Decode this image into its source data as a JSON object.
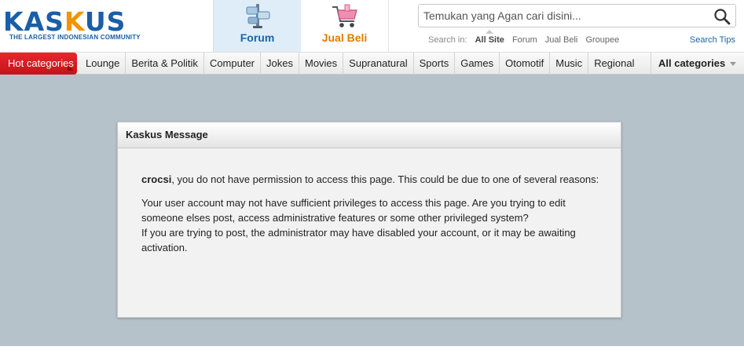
{
  "logo": {
    "text_a": "KAS",
    "text_o": "K",
    "text_b": "US",
    "tagline": "THE LARGEST INDONESIAN COMMUNITY"
  },
  "nav": {
    "forum_label": "Forum",
    "jualbeli_label": "Jual Beli"
  },
  "search": {
    "placeholder": "Temukan yang Agan cari disini...",
    "scope_label": "Search in:",
    "scopes": [
      "All Site",
      "Forum",
      "Jual Beli",
      "Groupee"
    ],
    "tips": "Search Tips"
  },
  "categories": {
    "hot": "Hot categories",
    "items": [
      "Lounge",
      "Berita & Politik",
      "Computer",
      "Jokes",
      "Movies",
      "Supranatural",
      "Sports",
      "Games",
      "Otomotif",
      "Music",
      "Regional"
    ],
    "all": "All categories"
  },
  "message": {
    "title": "Kaskus Message",
    "username": "crocsi",
    "line1_rest": ", you do not have permission to access this page. This could be due to one of several reasons:",
    "para2": "Your user account may not have sufficient privileges to access this page. Are you trying to edit someone elses post, access administrative features or some other privileged system?",
    "para3": "If you are trying to post, the administrator may have disabled your account, or it may be awaiting activation."
  },
  "colors": {
    "brand_blue": "#1a5ea8",
    "brand_orange": "#f29400",
    "hot_red": "#d11f24",
    "page_bg": "#b6c2ca"
  },
  "icons": [
    "forum-megaphone-icon",
    "shopping-cart-icon",
    "search-icon"
  ]
}
